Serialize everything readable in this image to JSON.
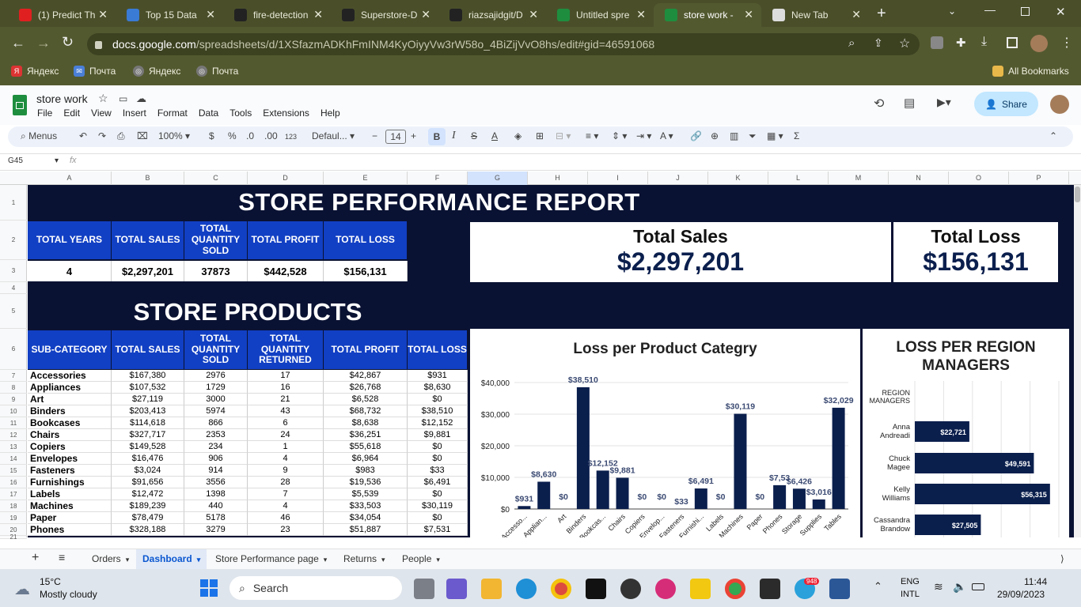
{
  "browser": {
    "tabs": [
      {
        "title": "(1) Predict Th",
        "icon": "youtube-icon",
        "color": "#e02020"
      },
      {
        "title": "Top 15 Data",
        "icon": "ib-icon",
        "color": "#3a7bd5"
      },
      {
        "title": "fire-detection",
        "icon": "github-icon",
        "color": "#222222"
      },
      {
        "title": "Superstore-D",
        "icon": "github-icon",
        "color": "#222222"
      },
      {
        "title": "riazsajidgit/D",
        "icon": "github-icon",
        "color": "#222222"
      },
      {
        "title": "Untitled spre",
        "icon": "sheets-icon",
        "color": "#1e8e3e"
      },
      {
        "title": "store work -",
        "icon": "sheets-icon",
        "color": "#1e8e3e"
      },
      {
        "title": "New Tab",
        "icon": "chrome-icon",
        "color": "#dddddd"
      }
    ],
    "url_domain": "docs.google.com",
    "url_path": "/spreadsheets/d/1XSfazmADKhFmINM4KyOiyyVw3rW58o_4BiZijVvO8hs/edit#gid=46591068",
    "bookmarks": [
      "Яндекс",
      "Почта",
      "Яндекс",
      "Почта"
    ],
    "all_bookmarks": "All Bookmarks"
  },
  "sheets": {
    "doc_title": "store work",
    "menu": [
      "File",
      "Edit",
      "View",
      "Insert",
      "Format",
      "Data",
      "Tools",
      "Extensions",
      "Help"
    ],
    "share": "Share",
    "toolbar": {
      "menus": "Menus",
      "zoom": "100%",
      "currency": "$",
      "percent": "%",
      "dec_less": ".0",
      "dec_more": ".00",
      "num123": "123",
      "font": "Defaul...",
      "font_size": "14",
      "bold": "B",
      "italic": "I",
      "strike": "S",
      "textcolor": "A",
      "sigma": "Σ"
    },
    "cell_ref": "G45",
    "fx": "fx",
    "columns": [
      "A",
      "B",
      "C",
      "D",
      "E",
      "F",
      "G",
      "H",
      "I",
      "J",
      "K",
      "L",
      "M",
      "N",
      "O",
      "P"
    ],
    "rows": [
      "1",
      "2",
      "3",
      "4",
      "5",
      "6",
      "7",
      "8",
      "9",
      "10",
      "11",
      "12",
      "13",
      "14",
      "15",
      "16",
      "17",
      "18",
      "19",
      "20",
      "21"
    ]
  },
  "report": {
    "title": "STORE PERFORMANCE REPORT",
    "summary_headers": [
      "TOTAL YEARS",
      "TOTAL SALES",
      "TOTAL QUANTITY SOLD",
      "TOTAL PROFIT",
      "TOTAL LOSS"
    ],
    "summary_values": [
      "4",
      "$2,297,201",
      "37873",
      "$442,528",
      "$156,131"
    ],
    "kpi_sales_label": "Total Sales",
    "kpi_sales_value": "$2,297,201",
    "kpi_loss_label": "Total Loss",
    "kpi_loss_value": "$156,131",
    "products_title": "STORE PRODUCTS",
    "product_headers": [
      "SUB-CATEGORY",
      "TOTAL SALES",
      "TOTAL QUANTITY SOLD",
      "TOTAL QUANTITY RETURNED",
      "TOTAL PROFIT",
      "TOTAL LOSS"
    ],
    "products": [
      [
        "Accessories",
        "$167,380",
        "2976",
        "17",
        "$42,867",
        "$931"
      ],
      [
        "Appliances",
        "$107,532",
        "1729",
        "16",
        "$26,768",
        "$8,630"
      ],
      [
        "Art",
        "$27,119",
        "3000",
        "21",
        "$6,528",
        "$0"
      ],
      [
        "Binders",
        "$203,413",
        "5974",
        "43",
        "$68,732",
        "$38,510"
      ],
      [
        "Bookcases",
        "$114,618",
        "866",
        "6",
        "$8,638",
        "$12,152"
      ],
      [
        "Chairs",
        "$327,717",
        "2353",
        "24",
        "$36,251",
        "$9,881"
      ],
      [
        "Copiers",
        "$149,528",
        "234",
        "1",
        "$55,618",
        "$0"
      ],
      [
        "Envelopes",
        "$16,476",
        "906",
        "4",
        "$6,964",
        "$0"
      ],
      [
        "Fasteners",
        "$3,024",
        "914",
        "9",
        "$983",
        "$33"
      ],
      [
        "Furnishings",
        "$91,656",
        "3556",
        "28",
        "$19,536",
        "$6,491"
      ],
      [
        "Labels",
        "$12,472",
        "1398",
        "7",
        "$5,539",
        "$0"
      ],
      [
        "Machines",
        "$189,239",
        "440",
        "4",
        "$33,503",
        "$30,119"
      ],
      [
        "Paper",
        "$78,479",
        "5178",
        "46",
        "$34,054",
        "$0"
      ],
      [
        "Phones",
        "$328,188",
        "3279",
        "23",
        "$51,887",
        "$7,531"
      ]
    ]
  },
  "chart_data": [
    {
      "type": "bar",
      "title": "Loss per Product Categry",
      "categories": [
        "Accesso...",
        "Applian...",
        "Art",
        "Binders",
        "Bookcas...",
        "Chairs",
        "Copiers",
        "Envelop...",
        "Fasteners",
        "Furnishi...",
        "Labels",
        "Machines",
        "Paper",
        "Phones",
        "Storage",
        "Supplies",
        "Tables"
      ],
      "values": [
        931,
        8630,
        0,
        38510,
        12152,
        9881,
        0,
        0,
        33,
        6491,
        0,
        30119,
        0,
        7531,
        6426,
        3016,
        32029
      ],
      "data_labels": [
        "$931",
        "$8,630",
        "$0",
        "$38,510",
        "$12,152",
        "$9,881",
        "$0",
        "$0",
        "$33",
        "$6,491",
        "$0",
        "$30,119",
        "$0",
        "$7,53",
        "$6,426",
        "$3,016",
        "$32,029"
      ],
      "yticks": [
        "$0",
        "$10,000",
        "$20,000",
        "$30,000",
        "$40,000"
      ],
      "ylim": [
        0,
        40000
      ],
      "color": "#0b1f4d"
    },
    {
      "type": "bar",
      "orientation": "horizontal",
      "title": "LOSS PER REGION MANAGERS",
      "axis_label": "REGION MANAGERS",
      "categories": [
        "Anna Andreadi",
        "Chuck Magee",
        "Kelly Williams",
        "Cassandra Brandow"
      ],
      "values": [
        22721,
        49591,
        56315,
        27505
      ],
      "data_labels": [
        "$22,721",
        "$49,591",
        "$56,315",
        "$27,505"
      ],
      "xlim": [
        0,
        60000
      ],
      "color": "#0b1f4d"
    }
  ],
  "sheet_tabs": [
    "Orders",
    "Dashboard",
    "Store Performance page",
    "Returns",
    "People"
  ],
  "taskbar": {
    "temp": "15°C",
    "weather": "Mostly cloudy",
    "search": "Search",
    "lang1": "ENG",
    "lang2": "INTL",
    "time": "11:44",
    "date": "29/09/2023",
    "badge": "948"
  }
}
